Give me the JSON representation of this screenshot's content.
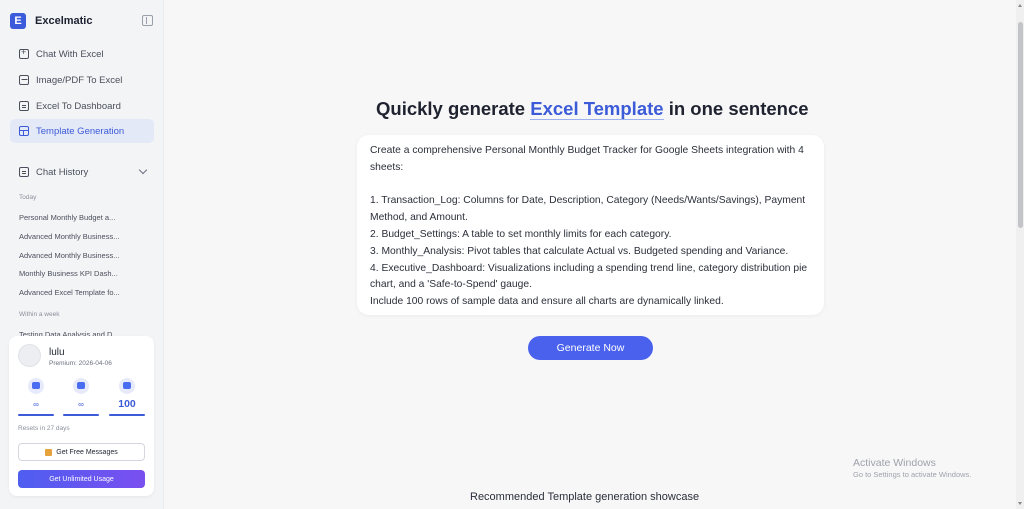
{
  "brand": {
    "logo_letter": "E",
    "name": "Excelmatic"
  },
  "nav": [
    {
      "label": "Chat With Excel",
      "icon": "chat-plus-icon"
    },
    {
      "label": "Image/PDF To Excel",
      "icon": "image-icon"
    },
    {
      "label": "Excel To Dashboard",
      "icon": "dashboard-icon"
    },
    {
      "label": "Template Generation",
      "icon": "template-grid-icon"
    }
  ],
  "history": {
    "title": "Chat History",
    "today_label": "Today",
    "today": [
      "Personal Monthly Budget a...",
      "Advanced Monthly Business...",
      "Advanced Monthly Business...",
      "Monthly Business KPI Dash...",
      "Advanced Excel Template fo..."
    ],
    "week_label": "Within a week",
    "week": [
      "Testing Data Analysis and D..."
    ]
  },
  "user": {
    "name": "lulu",
    "plan": "Premium: 2026-04-06",
    "quotas": [
      {
        "icon": "message-icon",
        "value": "∞"
      },
      {
        "icon": "image-icon",
        "value": "∞"
      },
      {
        "icon": "chart-icon",
        "value": "100"
      }
    ],
    "resets": "Resets in 27 days",
    "free_button": "Get Free Messages",
    "unlimited_button": "Get Unlimited Usage"
  },
  "main": {
    "headline_pre": "Quickly generate ",
    "headline_accent": "Excel Template",
    "headline_post": " in one sentence",
    "prompt": "Create a comprehensive Personal Monthly Budget Tracker for Google Sheets integration with 4 sheets:\n\n1. Transaction_Log: Columns for Date, Description, Category (Needs/Wants/Savings), Payment Method, and Amount.\n2. Budget_Settings: A table to set monthly limits for each category.\n3. Monthly_Analysis: Pivot tables that calculate Actual vs. Budgeted spending and Variance.\n4. Executive_Dashboard: Visualizations including a spending trend line, category distribution pie chart, and a 'Safe-to-Spend' gauge.\nInclude 100 rows of sample data and ensure all charts are dynamically linked.",
    "generate_button": "Generate Now",
    "showcase_title": "Recommended Template generation showcase"
  },
  "watermark": {
    "title": "Activate Windows",
    "subtitle": "Go to Settings to activate Windows."
  },
  "colors": {
    "accent": "#3c5bd8",
    "button": "#4a61ee"
  }
}
